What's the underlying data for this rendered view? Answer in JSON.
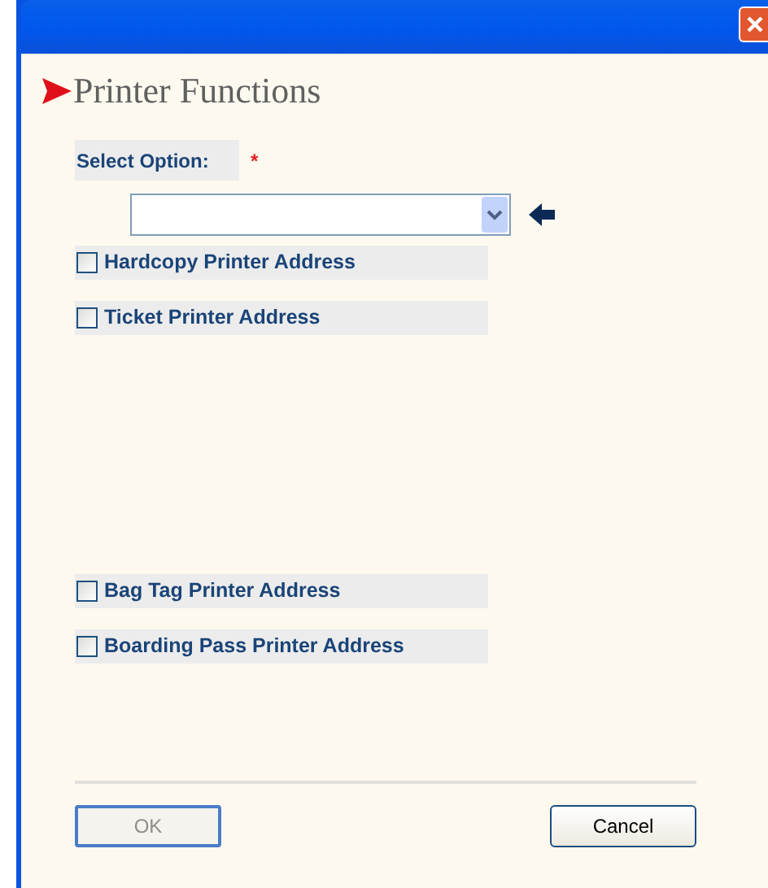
{
  "heading": "Printer Functions",
  "select": {
    "label": "Select Option:",
    "required_mark": "*"
  },
  "options": [
    {
      "label": "Hardcopy Printer Address",
      "checked": false
    },
    {
      "label": "Ticket Printer Address",
      "checked": false
    },
    {
      "label": "Bag Tag Printer Address",
      "checked": false
    },
    {
      "label": "Boarding Pass Printer Address",
      "checked": false
    }
  ],
  "buttons": [
    {
      "label": "OK",
      "disabled": true
    },
    {
      "label": "Cancel",
      "disabled": false
    }
  ]
}
